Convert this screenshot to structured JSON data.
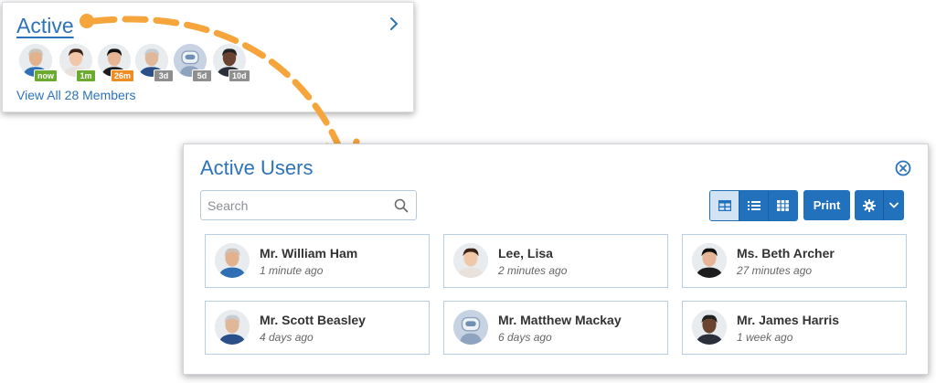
{
  "widget": {
    "title": "Active",
    "link": "View All 28 Members",
    "members": [
      {
        "badge": "now",
        "badge_color": "#6aaa2f",
        "skin": "#e2b28f",
        "hair": "#c9c3bb",
        "shirt": "#2f6fb3"
      },
      {
        "badge": "1m",
        "badge_color": "#6aaa2f",
        "skin": "#f0c7a9",
        "hair": "#3b2316",
        "shirt": "#e9e2dc"
      },
      {
        "badge": "26m",
        "badge_color": "#ef8d24",
        "skin": "#e6b595",
        "hair": "#111111",
        "shirt": "#1d1d1d"
      },
      {
        "badge": "3d",
        "badge_color": "#8f8f8f",
        "skin": "#e1b79a",
        "hair": "#c7cdd6",
        "shirt": "#2b4f89"
      },
      {
        "badge": "5d",
        "badge_color": "#8f8f8f",
        "skin": "robot",
        "hair": "",
        "shirt": ""
      },
      {
        "badge": "10d",
        "badge_color": "#8f8f8f",
        "skin": "#6b4331",
        "hair": "#222222",
        "shirt": "#2a2f3a"
      }
    ]
  },
  "panel": {
    "title": "Active Users",
    "search_placeholder": "Search",
    "print_label": "Print",
    "users": [
      {
        "name": "Mr. William Ham",
        "time": "1 minute ago",
        "skin": "#e2b28f",
        "hair": "#c9c3bb",
        "shirt": "#2f6fb3"
      },
      {
        "name": "Lee, Lisa",
        "time": "2 minutes ago",
        "skin": "#f0c7a9",
        "hair": "#3b2316",
        "shirt": "#e9e2dc"
      },
      {
        "name": "Ms. Beth Archer",
        "time": "27 minutes ago",
        "skin": "#e6b595",
        "hair": "#111111",
        "shirt": "#1d1d1d"
      },
      {
        "name": "Mr. Scott Beasley",
        "time": "4 days ago",
        "skin": "#e1b79a",
        "hair": "#c7cdd6",
        "shirt": "#2b4f89"
      },
      {
        "name": "Mr. Matthew Mackay",
        "time": "6 days ago",
        "skin": "robot",
        "hair": "",
        "shirt": ""
      },
      {
        "name": "Mr. James Harris",
        "time": "1 week ago",
        "skin": "#6b4331",
        "hair": "#222222",
        "shirt": "#2a2f3a"
      }
    ]
  },
  "colors": {
    "accent": "#2171bd",
    "link": "#2d73b9",
    "arrow": "#f5a53c"
  }
}
